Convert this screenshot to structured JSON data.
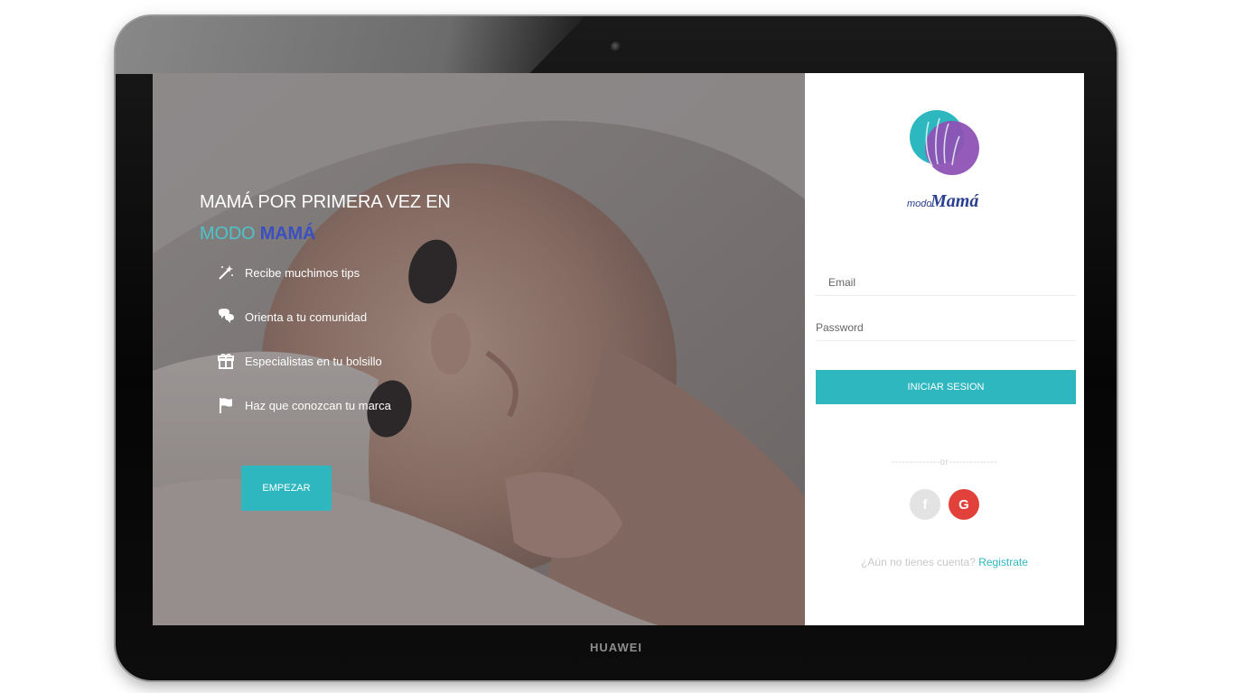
{
  "device": {
    "brand": "HUAWEI"
  },
  "hero": {
    "title": "MAMÁ POR PRIMERA VEZ EN",
    "subtitle_modo": "MODO",
    "subtitle_mama": "MAMÁ",
    "features": [
      {
        "icon": "magic-wand-icon",
        "label": "Recibe muchimos tips"
      },
      {
        "icon": "chat-bubbles-icon",
        "label": "Orienta a tu comunidad"
      },
      {
        "icon": "gift-icon",
        "label": "Especialistas en tu bolsillo"
      },
      {
        "icon": "flag-icon",
        "label": "Haz que conozcan tu marca"
      }
    ],
    "cta_label": "EMPEZAR",
    "cta_color": "#2fb7c0"
  },
  "login": {
    "logo_text_modo": "modo",
    "logo_text_mama": "Mamá",
    "email_placeholder": "Email",
    "password_placeholder": "Password",
    "submit_label": "INICIAR SESION",
    "divider_text": "--------------or--------------",
    "facebook_label": "f",
    "google_label": "G",
    "signup_prompt": "¿Aún no tienes cuenta?",
    "signup_link": "Registrate"
  },
  "colors": {
    "accent": "#2fb7c0",
    "google": "#e1413a",
    "logo_purple": "#8e52b5",
    "logo_teal": "#2db8c0"
  }
}
